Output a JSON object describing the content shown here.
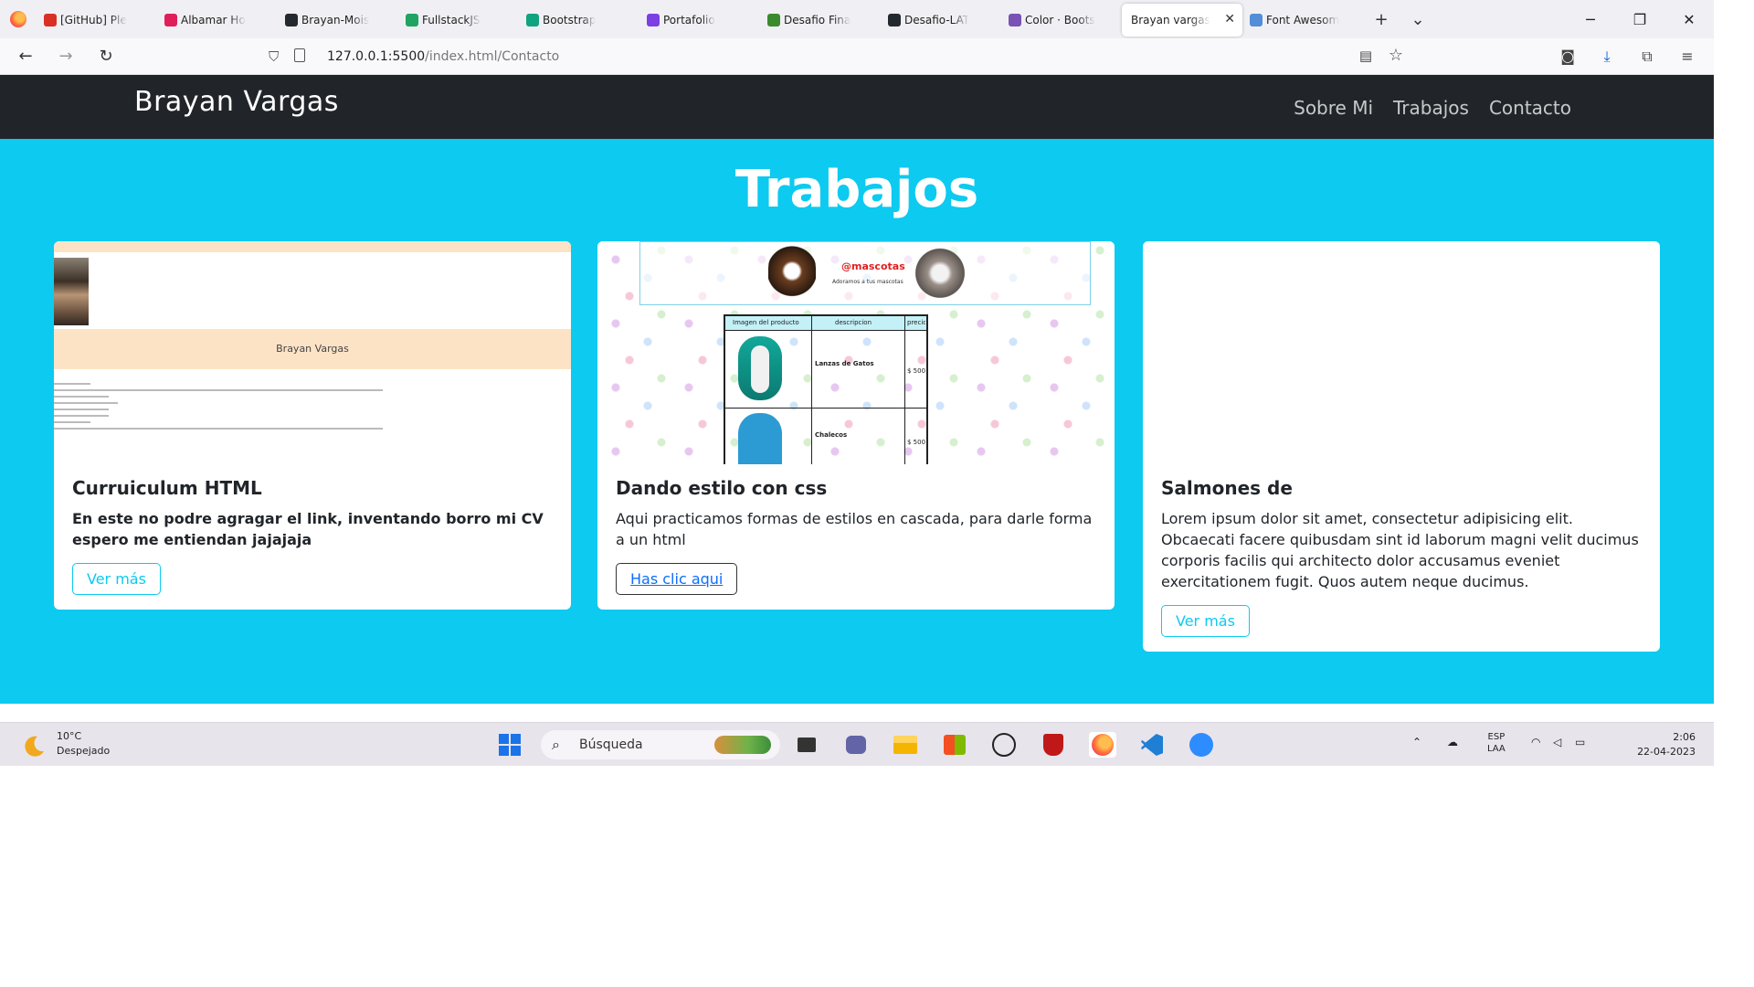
{
  "browser": {
    "tabs": [
      {
        "label": "[GitHub] Ple",
        "icon": "gmail-icon",
        "color": "#d93025"
      },
      {
        "label": "Albamar Ho",
        "icon": "slack-icon",
        "color": "#e01e5a"
      },
      {
        "label": "Brayan-Mois",
        "icon": "github-icon",
        "color": "#24292f"
      },
      {
        "label": "FullstackJS",
        "icon": "google-drive-icon",
        "color": "#1fa463"
      },
      {
        "label": "Bootstrap",
        "icon": "chatgpt-icon",
        "color": "#10a37f"
      },
      {
        "label": "Portafolio",
        "icon": "pencil-icon",
        "color": "#7b3fe4"
      },
      {
        "label": "Desafio Fina",
        "icon": "spreadsheet-icon",
        "color": "#3c8a2e"
      },
      {
        "label": "Desafio-LAT",
        "icon": "github-icon",
        "color": "#24292f"
      },
      {
        "label": "Color · Boots",
        "icon": "bootstrap-icon",
        "color": "#7952b3"
      },
      {
        "label": "Brayan vargas",
        "icon": "",
        "color": "#ffffff",
        "active": true
      },
      {
        "label": "Font Awesom",
        "icon": "flag-icon",
        "color": "#538dd7"
      }
    ],
    "url": "127.0.0.1:5500",
    "url_path": "/index.html/Contacto"
  },
  "site": {
    "brand": "Brayan Vargas",
    "nav": [
      "Sobre Mi",
      "Trabajos",
      "Contacto"
    ],
    "section_title": "Trabajos",
    "cards": [
      {
        "title": "Curruiculum HTML",
        "text": "En este no podre agragar el link, inventando borro mi CV espero me entiendan jajajaja",
        "button": "Ver más",
        "thumb_name": "Brayan Vargas"
      },
      {
        "title": "Dando estilo con css",
        "text": "Aqui practicamos formas de estilos en cascada, para darle forma a un html",
        "button": "Has clic aqui",
        "thumb_title": "@mascotas",
        "thumb_subtitle": "Adoramos a tus mascotas",
        "thumb_headers": [
          "Imagen del producto",
          "descripcion",
          "precio"
        ],
        "thumb_rows": [
          {
            "name": "Lanzas de Gatos",
            "price": "$ 500"
          },
          {
            "name": "Chalecos",
            "price": "$ 500"
          }
        ]
      },
      {
        "title": "Salmones de",
        "text": "Lorem ipsum dolor sit amet, consectetur adipisicing elit. Obcaecati facere quibusdam sint id laborum magni velit ducimus corporis facilis qui architecto dolor accusamus eveniet exercitationem fugit. Quos autem neque ducimus.",
        "button": "Ver más"
      }
    ]
  },
  "taskbar": {
    "weather_temp": "10°C",
    "weather_desc": "Despejado",
    "search_placeholder": "Búsqueda",
    "lang_top": "ESP",
    "lang_bottom": "LAA",
    "time": "2:06",
    "date": "22-04-2023"
  },
  "colors": {
    "hero": "#0dcaf0",
    "navbar": "#212529",
    "accent": "#0dcaf0"
  }
}
